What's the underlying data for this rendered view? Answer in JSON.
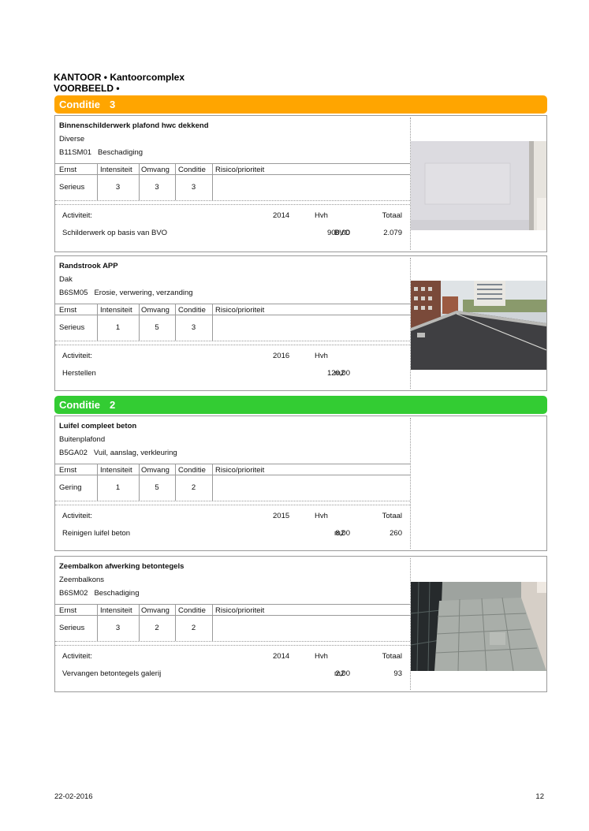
{
  "header": {
    "line1": "KANTOOR • Kantoorcomplex",
    "line2": "VOORBEELD •"
  },
  "groups": [
    {
      "label": "Conditie",
      "number": "3",
      "color": "#ffa500",
      "items": [
        {
          "title": "Binnenschilderwerk plafond hwc dekkend",
          "element": "Diverse",
          "code": "B11SM01",
          "defect": "Beschadiging",
          "table_headers": [
            "Ernst",
            "Intensiteit",
            "Omvang",
            "Conditie",
            "Risico/prioriteit"
          ],
          "ernst": "Serieus",
          "intensiteit": "3",
          "omvang": "3",
          "conditie": "3",
          "risico": "",
          "activity_label": "Activiteit:",
          "year": "2014",
          "hvh_label": "Hvh",
          "totaal_label": "Totaal",
          "activity": "Schilderwerk op basis van BVO",
          "quantity": "900,00",
          "unit": "BVO",
          "total": "2.079",
          "photo": "white-ceiling-panel"
        },
        {
          "title": "Randstrook APP",
          "element": "Dak",
          "code": "B6SM05",
          "defect": "Erosie, verwering, verzanding",
          "table_headers": [
            "Ernst",
            "Intensiteit",
            "Omvang",
            "Conditie",
            "Risico/prioriteit"
          ],
          "ernst": "Serieus",
          "intensiteit": "1",
          "omvang": "5",
          "conditie": "3",
          "risico": "",
          "activity_label": "Activiteit:",
          "year": "2016",
          "hvh_label": "Hvh",
          "totaal_label": "",
          "activity": "Herstellen",
          "quantity": "120,00",
          "unit": "m2",
          "total": "",
          "photo": "flat-roof-buildings"
        }
      ]
    },
    {
      "label": "Conditie",
      "number": "2",
      "color": "#33cc33",
      "items": [
        {
          "title": "Luifel compleet beton",
          "element": "Buitenplafond",
          "code": "B5GA02",
          "defect": "Vuil, aanslag, verkleuring",
          "table_headers": [
            "Ernst",
            "Intensiteit",
            "Omvang",
            "Conditie",
            "Risico/prioriteit"
          ],
          "ernst": "Gering",
          "intensiteit": "1",
          "omvang": "5",
          "conditie": "2",
          "risico": "",
          "activity_label": "Activiteit:",
          "year": "2015",
          "hvh_label": "Hvh",
          "totaal_label": "Totaal",
          "activity": "Reinigen luifel beton",
          "quantity": "8,00",
          "unit": "m2",
          "total": "260",
          "photo": ""
        },
        {
          "title": "Zeembalkon afwerking betontegels",
          "element": "Zeembalkons",
          "code": "B6SM02",
          "defect": "Beschadiging",
          "table_headers": [
            "Ernst",
            "Intensiteit",
            "Omvang",
            "Conditie",
            "Risico/prioriteit"
          ],
          "ernst": "Serieus",
          "intensiteit": "3",
          "omvang": "2",
          "conditie": "2",
          "risico": "",
          "activity_label": "Activiteit:",
          "year": "2014",
          "hvh_label": "Hvh",
          "totaal_label": "Totaal",
          "activity": "Vervangen betontegels galerij",
          "quantity": "2,00",
          "unit": "m2",
          "total": "93",
          "photo": "balcony-concrete-tiles"
        }
      ]
    }
  ],
  "footer": {
    "date": "22-02-2016",
    "page": "12"
  }
}
